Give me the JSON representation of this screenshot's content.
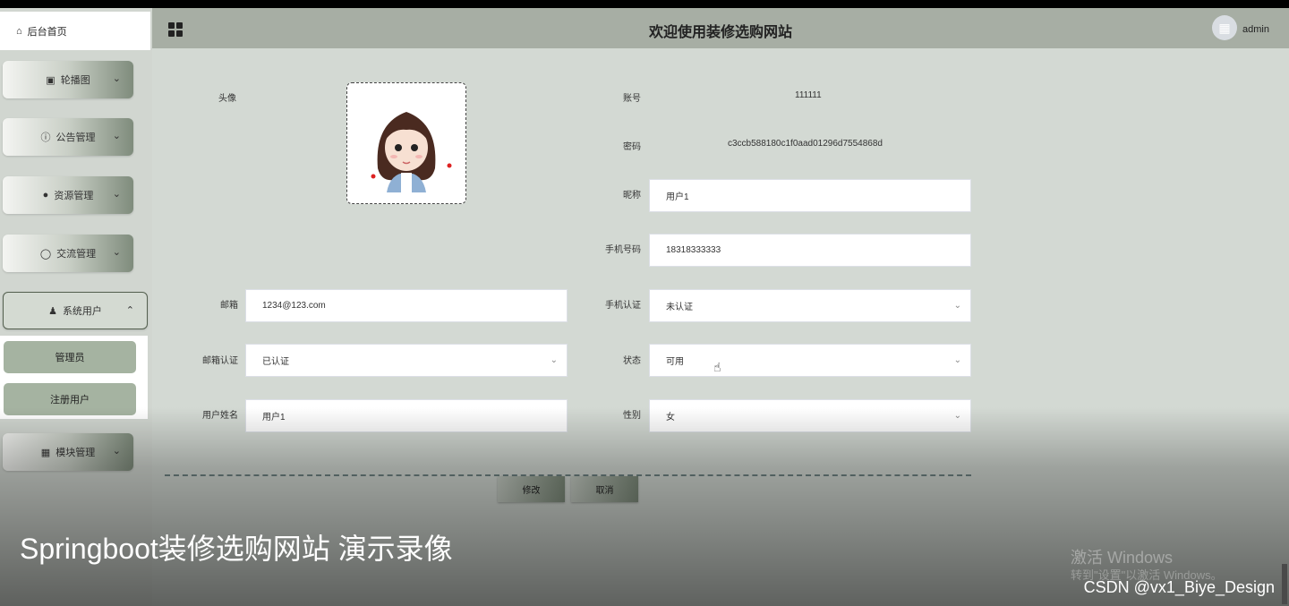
{
  "sidebar": {
    "home_label": "后台首页",
    "menu": [
      {
        "label": "轮播图",
        "icon": "image-icon"
      },
      {
        "label": "公告管理",
        "icon": "info-icon"
      },
      {
        "label": "资源管理",
        "icon": "bulb-icon"
      },
      {
        "label": "交流管理",
        "icon": "chat-icon"
      },
      {
        "label": "系统用户",
        "icon": "user-icon"
      },
      {
        "label": "模块管理",
        "icon": "grid-icon"
      }
    ],
    "submenu": [
      "管理员",
      "注册用户"
    ]
  },
  "header": {
    "title": "欢迎使用装修选购网站",
    "user": "admin"
  },
  "form": {
    "avatar_label": "头像",
    "account_label": "账号",
    "account_value": "111111",
    "password_label": "密码",
    "password_value": "c3ccb588180c1f0aad01296d7554868d",
    "nickname_label": "昵称",
    "nickname_value": "用户1",
    "phone_label": "手机号码",
    "phone_value": "18318333333",
    "email_label": "邮箱",
    "email_value": "1234@123.com",
    "phone_verify_label": "手机认证",
    "phone_verify_value": "未认证",
    "email_verify_label": "邮箱认证",
    "email_verify_value": "已认证",
    "status_label": "状态",
    "status_value": "可用",
    "realname_label": "用户姓名",
    "realname_value": "用户1",
    "gender_label": "性别",
    "gender_value": "女",
    "submit_label": "修改",
    "cancel_label": "取消"
  },
  "overlay": {
    "caption": "Springboot装修选购网站 演示录像",
    "watermark_title": "激活 Windows",
    "watermark_sub": "转到\"设置\"以激活 Windows。",
    "credit": "CSDN @vx1_Biye_Design"
  }
}
